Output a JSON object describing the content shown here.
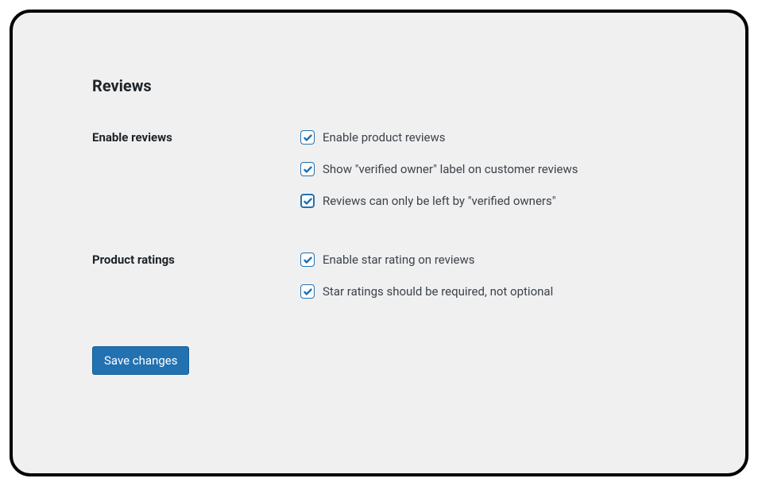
{
  "section": {
    "heading": "Reviews"
  },
  "rows": {
    "enable_reviews": {
      "label": "Enable reviews",
      "options": [
        {
          "label": "Enable product reviews",
          "checked": true
        },
        {
          "label": "Show \"verified owner\" label on customer reviews",
          "checked": true
        },
        {
          "label": "Reviews can only be left by \"verified owners\"",
          "checked": true,
          "focused": true
        }
      ]
    },
    "product_ratings": {
      "label": "Product ratings",
      "options": [
        {
          "label": "Enable star rating on reviews",
          "checked": true
        },
        {
          "label": "Star ratings should be required, not optional",
          "checked": true
        }
      ]
    }
  },
  "actions": {
    "save_label": "Save changes"
  }
}
